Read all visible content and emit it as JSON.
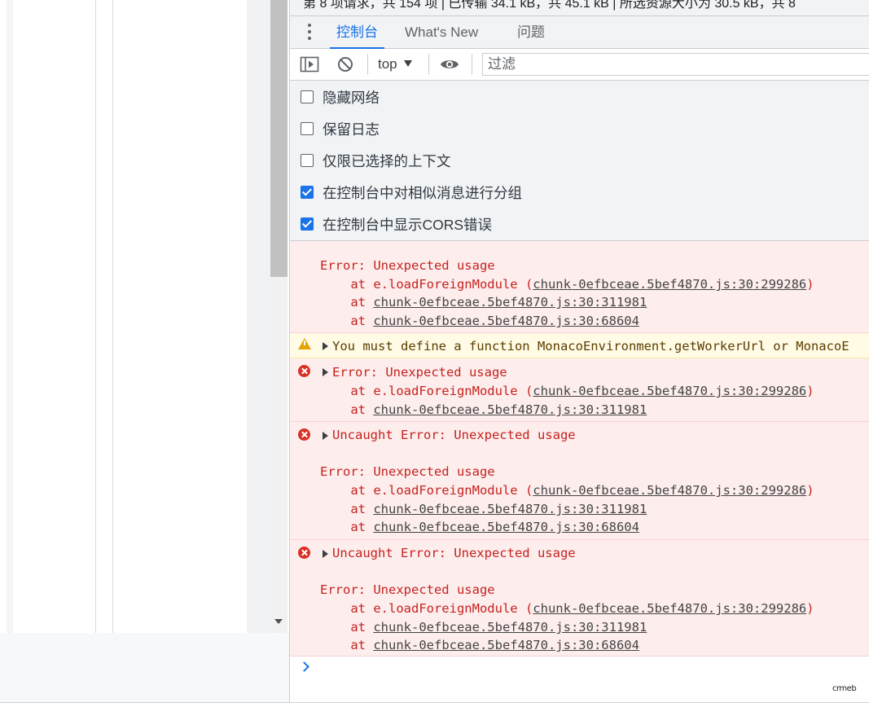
{
  "topbar": {
    "text": "第 8 项请求，共 154 项  |  已传输 34.1 kB，共 45.1 kB  |  所选资源大小为 30.5 kB，共 8"
  },
  "tabs": [
    {
      "label": "控制台",
      "active": true
    },
    {
      "label": "What's New",
      "active": false
    },
    {
      "label": "问题",
      "active": false
    }
  ],
  "toolbar": {
    "context": "top",
    "filter_placeholder": "过滤",
    "icons": [
      "sidebar-icon",
      "clear-console-icon",
      "live-expression-eye-icon"
    ]
  },
  "settings": [
    {
      "label": "隐藏网络",
      "checked": false
    },
    {
      "label": "保留日志",
      "checked": false
    },
    {
      "label": "仅限已选择的上下文",
      "checked": false
    },
    {
      "label": "在控制台中对相似消息进行分组",
      "checked": true
    },
    {
      "label": "在控制台中显示CORS错误",
      "checked": true
    }
  ],
  "messages": {
    "m1": {
      "title": "Error: Unexpected usage",
      "at1_prefix": "    at e.loadForeignModule (",
      "at1_link": "chunk-0efbceae.5bef4870.js:30:299286",
      "at1_suffix": ")",
      "at2_prefix": "    at ",
      "at2_link": "chunk-0efbceae.5bef4870.js:30:311981",
      "at3_prefix": "    at ",
      "at3_link": "chunk-0efbceae.5bef4870.js:30:68604"
    },
    "m2": {
      "text": "You must define a function MonacoEnvironment.getWorkerUrl or MonacoE"
    },
    "m3": {
      "title": "Error: Unexpected usage",
      "at1_prefix": "    at e.loadForeignModule (",
      "at1_link": "chunk-0efbceae.5bef4870.js:30:299286",
      "at1_suffix": ")",
      "at2_prefix": "    at ",
      "at2_link": "chunk-0efbceae.5bef4870.js:30:311981"
    },
    "m4": {
      "title": "Uncaught Error: Unexpected usage",
      "sub": "Error: Unexpected usage",
      "at1_prefix": "    at e.loadForeignModule (",
      "at1_link": "chunk-0efbceae.5bef4870.js:30:299286",
      "at1_suffix": ")",
      "at2_prefix": "    at ",
      "at2_link": "chunk-0efbceae.5bef4870.js:30:311981",
      "at3_prefix": "    at ",
      "at3_link": "chunk-0efbceae.5bef4870.js:30:68604"
    },
    "m5": {
      "title": "Uncaught Error: Unexpected usage",
      "sub": "Error: Unexpected usage",
      "at1_prefix": "    at e.loadForeignModule (",
      "at1_link": "chunk-0efbceae.5bef4870.js:30:299286",
      "at1_suffix": ")",
      "at2_prefix": "    at ",
      "at2_link": "chunk-0efbceae.5bef4870.js:30:311981",
      "at3_prefix": "    at ",
      "at3_link": "chunk-0efbceae.5bef4870.js:30:68604"
    }
  },
  "watermark": "crmeb",
  "colors": {
    "accent": "#1a73e8",
    "error": "#c5221f",
    "error_bg": "#fdeeed",
    "warning_bg": "#fffbe5"
  }
}
